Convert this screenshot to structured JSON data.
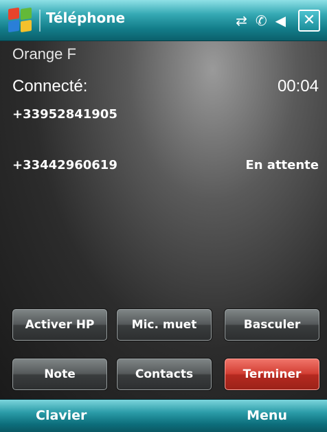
{
  "titlebar": {
    "title": "Téléphone",
    "icons": [
      "start-logo",
      "data-connection-icon",
      "phone-signal-icon",
      "volume-icon",
      "close-icon"
    ],
    "close_label": "✕"
  },
  "call": {
    "carrier": "Orange F",
    "status": "Connecté:",
    "timer": "00:04",
    "active_number": "+33952841905",
    "held_number": "+33442960619",
    "held_status": "En attente"
  },
  "buttons": {
    "speaker": "Activer HP",
    "mute": "Mic. muet",
    "swap": "Basculer",
    "note": "Note",
    "contacts": "Contacts",
    "end": "Terminer"
  },
  "softkeys": {
    "left": "Clavier",
    "right": "Menu"
  },
  "colors": {
    "titlebar": "#137e8b",
    "end_button": "#d23e33",
    "button": "#55595a"
  }
}
